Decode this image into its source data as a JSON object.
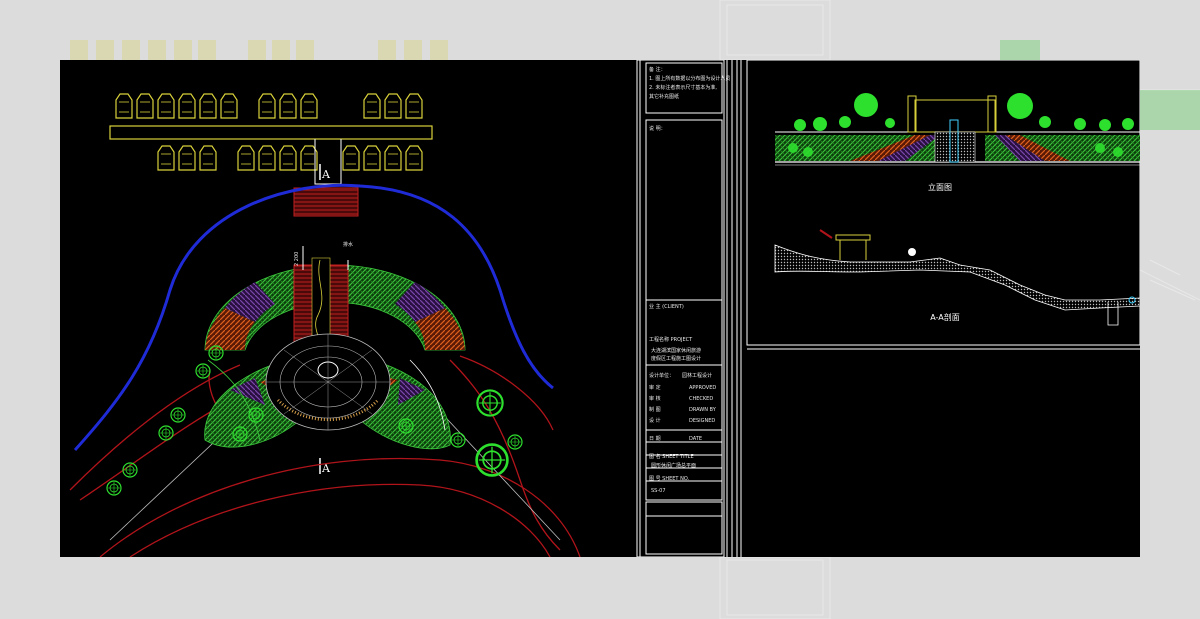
{
  "colors": {
    "sheet_bg": "#000000",
    "frame": "#dcdcdc",
    "wall_blue": "#1f2bd6",
    "path_red": "#b0141a",
    "parking_yellow": "#d8d03a",
    "hatch_green": "#3cc83c",
    "hatch_orange": "#d8501c",
    "hatch_purple": "#6a3c96",
    "tree_green": "#2ee02e"
  },
  "plan": {
    "section_marks": [
      "A",
      "A"
    ],
    "arrow_label_left": "2 200",
    "arrow_label_right": "排水"
  },
  "title_block": {
    "notes_header": "备 注：",
    "notes_lines": [
      "1. 图上所有数据以分布图为设计人员",
      "2. 未标注者表示尺寸基本为准,",
      "其它补充图纸"
    ],
    "remarks_header": "说 明：",
    "client_label": "业 主 (CLIENT)",
    "project_label": "工程名称 PROJECT",
    "project_name_lines": [
      "大连湖滨国家休闲旅游",
      "度假区工程施工图设计"
    ],
    "design_unit_label": "设计单位：",
    "design_unit_value": "园林工程设计",
    "staff": [
      {
        "role": "审 定",
        "code": "APPROVED"
      },
      {
        "role": "审 核",
        "code": "CHECKED"
      },
      {
        "role": "制 图",
        "code": "DRAWN BY"
      },
      {
        "role": "设 计",
        "code": "DESIGNED"
      },
      {
        "role": "日 期",
        "code": "DATE"
      }
    ],
    "sheet_title_label": "图 名 SHEET TITLE",
    "sheet_title_value": "圆形休闲广场总平面",
    "sheet_no_label": "图 号 SHEET NO.",
    "sheet_no_value": "SS-07"
  },
  "elevation": {
    "caption": "立面图"
  },
  "section": {
    "caption": "A-A剖面"
  }
}
